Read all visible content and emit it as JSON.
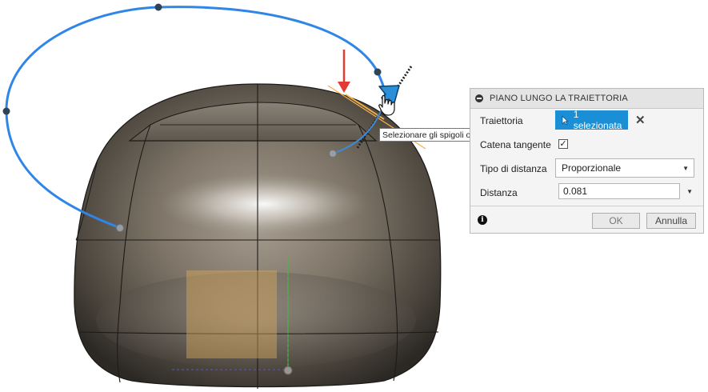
{
  "panel": {
    "title": "PIANO LUNGO LA TRAIETTORIA",
    "path_label": "Traiettoria",
    "path_selection": "1 selezionata",
    "tangent_chain_label": "Catena tangente",
    "tangent_chain_checked": true,
    "distance_type_label": "Tipo di distanza",
    "distance_type_value": "Proporzionale",
    "distance_label": "Distanza",
    "distance_value": "0.081",
    "ok_label": "OK",
    "cancel_label": "Annulla"
  },
  "tooltip": {
    "text": "Selezionare gli spigoli o le curve dello schizzo"
  },
  "colors": {
    "accent": "#1b8fd6",
    "sketch_curve": "#2f86e6",
    "arrow": "#e03c31",
    "plane_preview": "#f4b04a"
  },
  "icons": {
    "collapse": "minus-circle-icon",
    "select": "cursor-arrow-icon",
    "clear": "close-icon",
    "info": "info-icon",
    "pointer": "hand-pointer-icon"
  }
}
